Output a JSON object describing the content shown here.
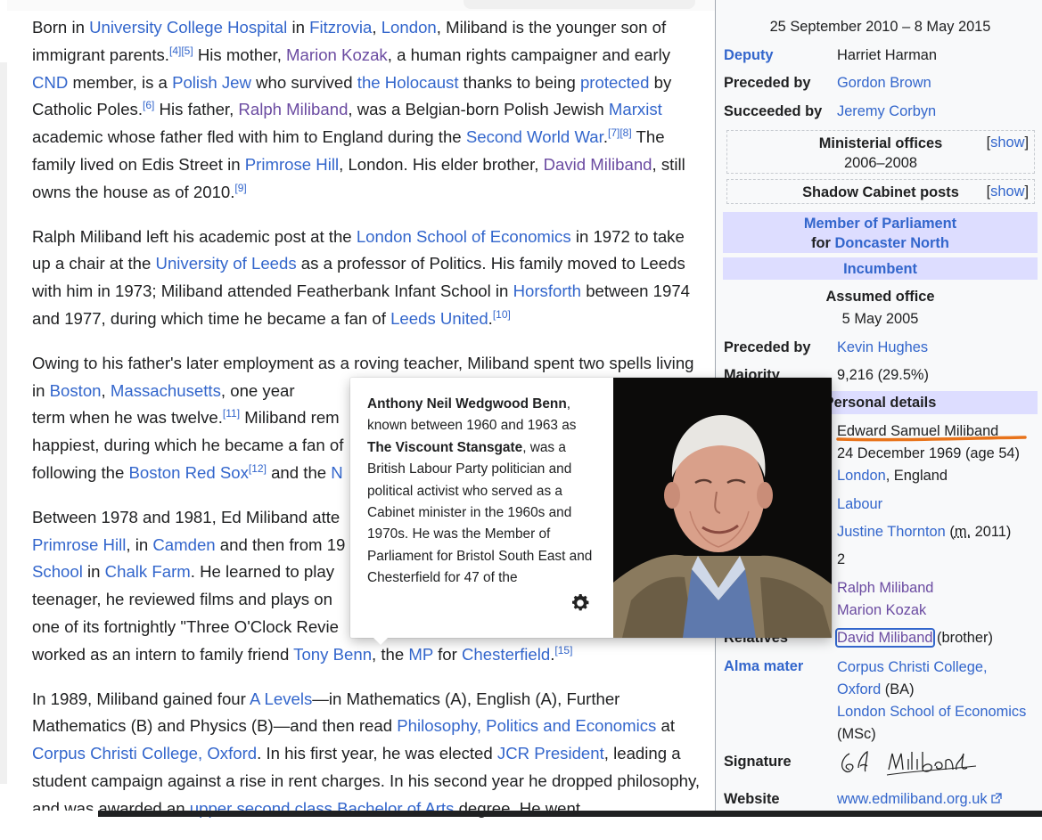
{
  "article": {
    "p1": {
      "t1": "Born in ",
      "l1": "University College Hospital",
      "t2": " in ",
      "l2": "Fitzrovia",
      "t3": ", ",
      "l3": "London",
      "t4": ", Miliband is the younger son of immigrant parents.",
      "r1": "[4]",
      "r2": "[5]",
      "t5": " His mother, ",
      "l4": "Marion Kozak",
      "t6": ", a human rights campaigner and early ",
      "l5": "CND",
      "t7": " member, is a ",
      "l6": "Polish Jew",
      "t8": " who survived ",
      "l7": "the Holocaust",
      "t9": " thanks to being ",
      "l8": "protected",
      "t10": " by Catholic Poles.",
      "r3": "[6]",
      "t11": " His father, ",
      "l9": "Ralph Miliband",
      "t12": ", was a Belgian-born Polish Jewish ",
      "l10": "Marxist",
      "t13": " academic whose father fled with him to England during the ",
      "l11": "Second World War",
      "t14": ".",
      "r4": "[7]",
      "r5": "[8]",
      "t15": " The family lived on Edis Street in ",
      "l12": "Primrose Hill",
      "t16": ", London. His elder brother, ",
      "l13": "David Miliband",
      "t17": ", still owns the house as of 2010.",
      "r6": "[9]"
    },
    "p2": {
      "t1": "Ralph Miliband left his academic post at the ",
      "l1": "London School of Economics",
      "t2": " in 1972 to take up a chair at the ",
      "l2": "University of Leeds",
      "t3": " as a professor of Politics. His family moved to Leeds with him in 1973; Miliband attended Featherbank Infant School in ",
      "l3": "Horsforth",
      "t4": " between 1974 and 1977, during which time he became a fan of ",
      "l4": "Leeds United",
      "t5": ".",
      "r1": "[10]"
    },
    "p3": {
      "t1": "Owing to his father's later employment as a roving teacher, Miliband spent two spells living in ",
      "l1": "Boston",
      "t2": ", ",
      "l2": "Massachusetts",
      "t3": ", one year ",
      "t4": "term when he was twelve.",
      "r1": "[11]",
      "t5": " Miliband rem",
      "t6": "happiest, during which he became a fan of",
      "t7": "following the ",
      "l3": "Boston Red Sox",
      "r2": "[12]",
      "t8": " and the ",
      "l4": "N"
    },
    "p4": {
      "t1": "Between 1978 and 1981, Ed Miliband atte",
      "l1": "Primrose Hill",
      "t2": ", in ",
      "l2": "Camden",
      "t3": " and then from 19",
      "l3": "School",
      "t4": " in ",
      "l4": "Chalk Farm",
      "t5": ". He learned to play ",
      "t6": "teenager, he reviewed films and plays on ",
      "t7": "one of its fortnightly \"Three O'Clock Revie",
      "t8": "worked as an intern to family friend ",
      "l5": "Tony Benn",
      "t9": ", the ",
      "l6": "MP",
      "t10": " for ",
      "l7": "Chesterfield",
      "t11": ".",
      "r1": "[15]"
    },
    "p5": {
      "t1": "In 1989, Miliband gained four ",
      "l1": "A Levels",
      "t2": "—in Mathematics (A), English (A), Further Mathematics (B) and Physics (B)—and then read ",
      "l2": "Philosophy, Politics and Economics",
      "t3": " at ",
      "l3": "Corpus Christi College, Oxford",
      "t4": ". In his first year, he was elected ",
      "l4": "JCR President",
      "t5": ", leading a student campaign against a rise in rent charges. In his second year he dropped philosophy, and was awarded an ",
      "l5": "upper second class Bachelor of Arts",
      "t6": " degree. He went"
    }
  },
  "infobox": {
    "term": "25 September 2010 – 8 May 2015",
    "rows1": [
      {
        "label": "Deputy",
        "value": "Harriet Harman",
        "label_link": true,
        "value_link": false
      },
      {
        "label": "Preceded by",
        "value": "Gordon Brown",
        "label_link": false,
        "value_link": true
      },
      {
        "label": "Succeeded by",
        "value": "Jeremy Corbyn",
        "label_link": false,
        "value_link": true
      }
    ],
    "ministerial": {
      "title": "Ministerial offices",
      "years": "2006–2008",
      "show": "show"
    },
    "shadow": {
      "title": "Shadow Cabinet posts",
      "show": "show"
    },
    "mp_header": {
      "l1": "Member of Parliament",
      "for": "for ",
      "l2": "Doncaster North"
    },
    "incumbent": "Incumbent",
    "assumed_label": "Assumed office",
    "assumed_date": "5 May 2005",
    "rows2": [
      {
        "label": "Preceded by",
        "value": "Kevin Hughes",
        "value_link": true
      },
      {
        "label": "Majority",
        "value": "9,216 (29.5%)",
        "value_link": false
      }
    ],
    "personal_header": "Personal details",
    "born_name": "Edward Samuel Miliband",
    "born_date": "24 December 1969 (age 54)",
    "born_place_link": "London",
    "born_place_rest": ", England",
    "party": "Labour",
    "spouse_link": "Justine Thornton",
    "spouse_m": "m.",
    "spouse_year": " 2011)",
    "spouse_open": " (",
    "children": "2",
    "parent1": "Ralph Miliband",
    "parent2": "Marion Kozak",
    "relatives_label": "Relatives",
    "relatives_link": "David Miliband",
    "relatives_rest": " (brother)",
    "alma_label": "Alma mater",
    "alma1a": "Corpus Christi College,",
    "alma1b": "Oxford",
    "alma1c": " (BA)",
    "alma2": "London School of Economics",
    "alma2c": "(MSc)",
    "signature_label": "Signature",
    "signature_text": "Ed Miliband",
    "website_label": "Website",
    "website": "www.edmiliband.org.uk"
  },
  "popup": {
    "name": "Anthony Neil Wedgwood Benn",
    "t1": ", known between 1960 and 1963 as ",
    "title": "The Viscount Stansgate",
    "t2": ", was a British Labour Party politician and political activist who served as a Cabinet minister in the 1960s and 1970s. He was the Member of Parliament for Bristol South East and Chesterfield for 47 of the"
  },
  "colors": {
    "link": "#3366cc",
    "visited": "#6b4ba1",
    "header_bg": "#ddddff",
    "underline": "#e8731a"
  }
}
